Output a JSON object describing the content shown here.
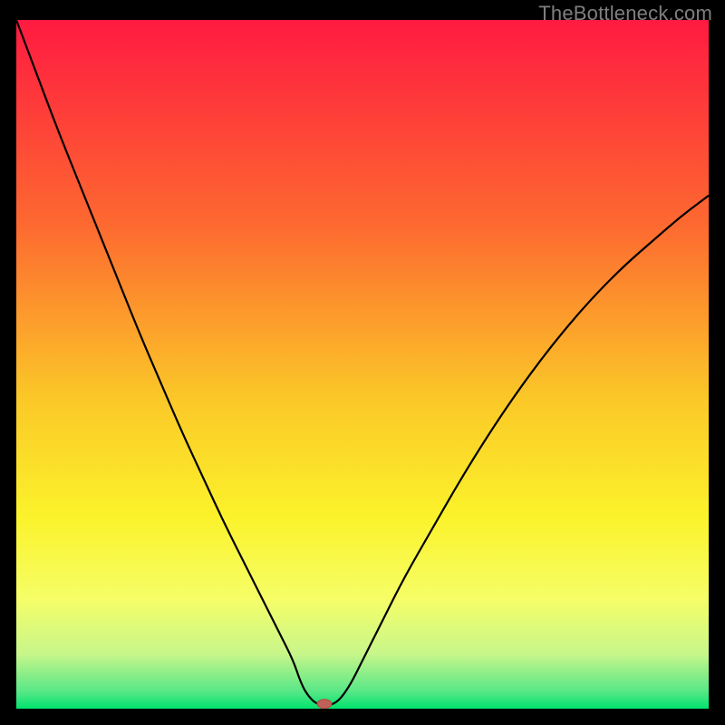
{
  "watermark": "TheBottleneck.com",
  "colors": {
    "frame": "#000000",
    "watermark": "#7f7f7f",
    "gradient_top": "#ff1a41",
    "gradient_mid1": "#fd7a2f",
    "gradient_mid2": "#fbe424",
    "gradient_mid3": "#f6fe67",
    "gradient_mid4": "#9fe98c",
    "gradient_bottom": "#00e36e",
    "curve": "#000000",
    "marker_fill": "#c06058",
    "marker_stroke": "#b64d44"
  },
  "chart_data": {
    "type": "line",
    "title": "",
    "xlabel": "",
    "ylabel": "",
    "xlim": [
      0,
      100
    ],
    "ylim": [
      0,
      100
    ],
    "series": [
      {
        "name": "bottleneck-curve",
        "x": [
          0,
          3,
          6,
          9,
          12,
          15,
          18,
          21,
          24,
          27,
          30,
          33,
          36,
          38,
          40,
          41,
          42,
          43.5,
          46,
          48,
          50,
          53,
          56,
          60,
          64,
          68,
          72,
          76,
          80,
          84,
          88,
          92,
          96,
          100
        ],
        "y": [
          100,
          92,
          84,
          76.5,
          69,
          61.5,
          54,
          47,
          40,
          33.5,
          27,
          21,
          15,
          11,
          7,
          4,
          2,
          0.5,
          0.5,
          3,
          7,
          13,
          19,
          26,
          33,
          39.5,
          45.5,
          51,
          56,
          60.5,
          64.5,
          68,
          71.5,
          74.5
        ]
      }
    ],
    "flat_region": {
      "x_start": 41,
      "x_end": 46,
      "y": 0.5
    },
    "marker": {
      "x": 44.5,
      "y": 0.7
    },
    "gradient_stops": [
      {
        "offset": 0.0,
        "color": "#ff1a41"
      },
      {
        "offset": 0.3,
        "color": "#fd6a30"
      },
      {
        "offset": 0.55,
        "color": "#fbc828"
      },
      {
        "offset": 0.72,
        "color": "#fbf22a"
      },
      {
        "offset": 0.84,
        "color": "#f6fe67"
      },
      {
        "offset": 0.92,
        "color": "#c8f68a"
      },
      {
        "offset": 0.975,
        "color": "#58e787"
      },
      {
        "offset": 1.0,
        "color": "#00e36e"
      }
    ]
  }
}
